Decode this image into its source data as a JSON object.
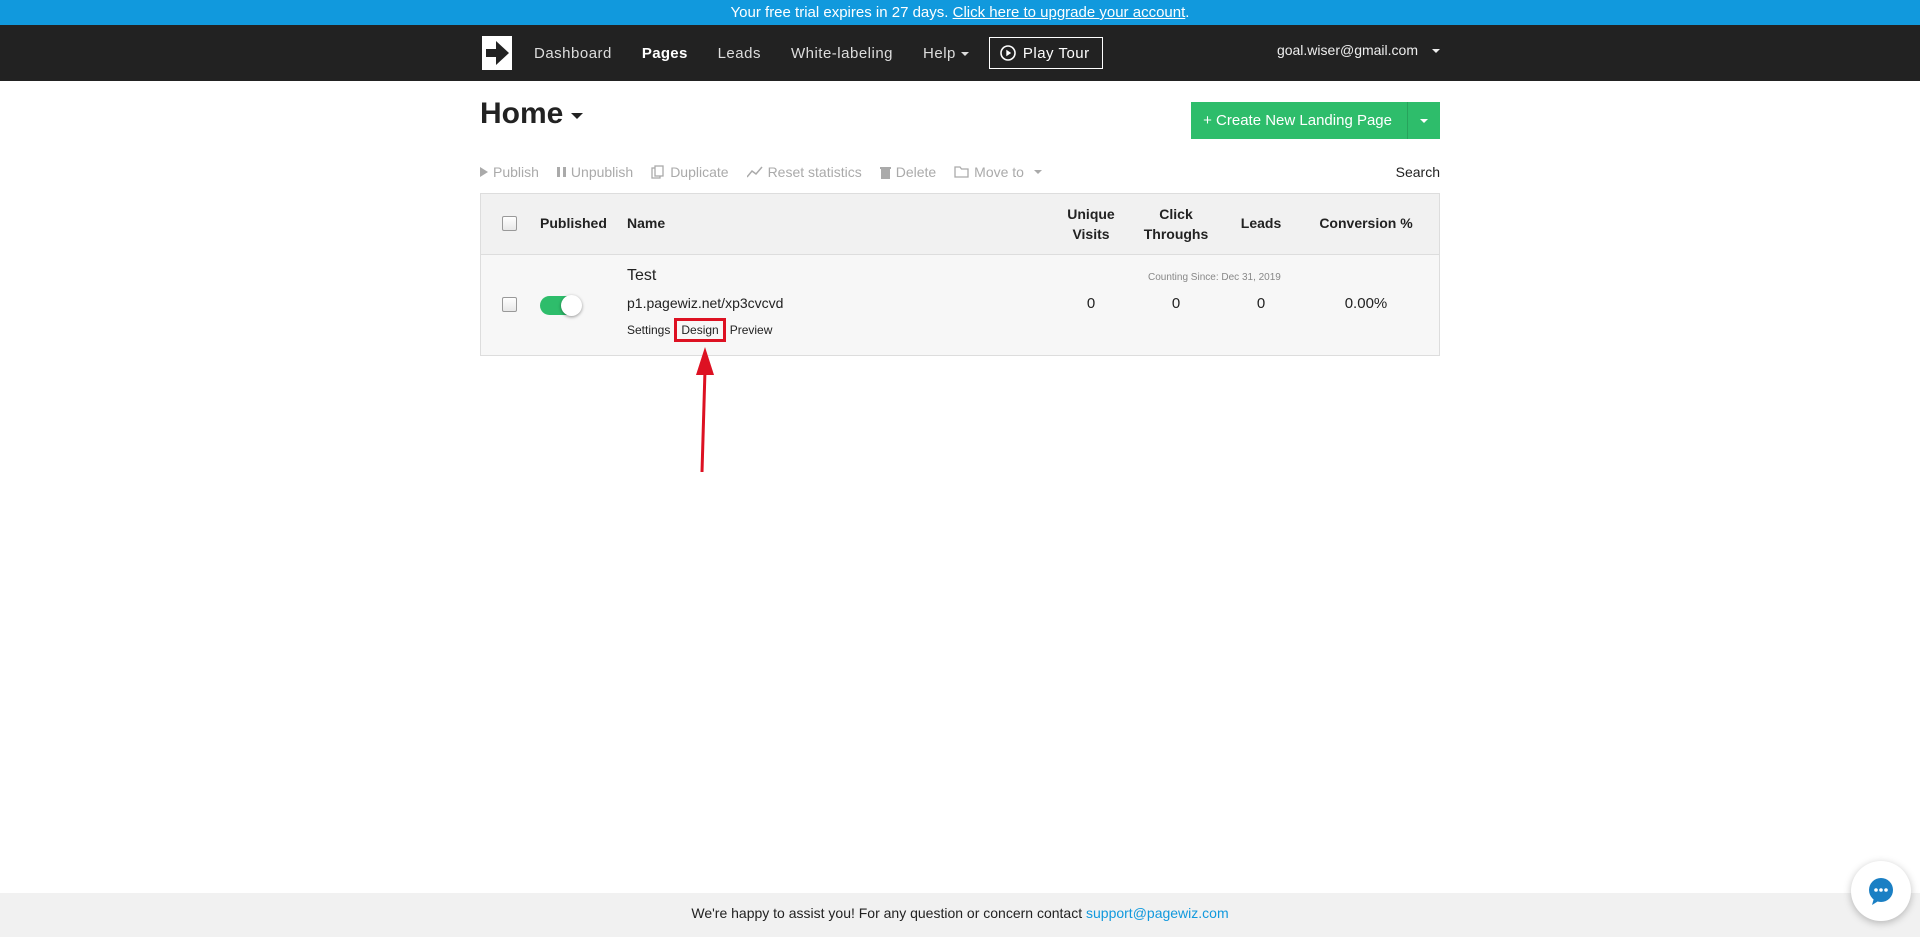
{
  "trial_bar": {
    "text": "Your free trial expires in 27 days.",
    "link": "Click here to upgrade your account",
    "period": "."
  },
  "nav": {
    "logo_icon": "arrow-right-logo-icon",
    "items": [
      "Dashboard",
      "Pages",
      "Leads",
      "White-labeling",
      "Help"
    ],
    "active": "Pages",
    "play_tour": "Play Tour",
    "user_email": "goal.wiser@gmail.com"
  },
  "header": {
    "title": "Home",
    "create_button": "+ Create New Landing Page"
  },
  "toolbar": {
    "publish": "Publish",
    "unpublish": "Unpublish",
    "duplicate": "Duplicate",
    "reset": "Reset statistics",
    "delete": "Delete",
    "move_to": "Move to",
    "search": "Search"
  },
  "table": {
    "columns": {
      "published": "Published",
      "name": "Name",
      "unique_visits_1": "Unique",
      "unique_visits_2": "Visits",
      "click_throughs_1": "Click",
      "click_throughs_2": "Throughs",
      "leads": "Leads",
      "conversion": "Conversion %"
    },
    "rows": [
      {
        "name": "Test",
        "url": "p1.pagewiz.net/xp3cvcvd",
        "links": {
          "settings": "Settings",
          "design": "Design",
          "preview": "Preview"
        },
        "counting_since": "Counting Since: Dec 31, 2019",
        "unique_visits": "0",
        "click_throughs": "0",
        "leads": "0",
        "conversion": "0.00%",
        "published": true
      }
    ]
  },
  "footer": {
    "text": "We're happy to assist you! For any question or concern contact ",
    "email": "support@pagewiz.com"
  },
  "colors": {
    "trial_bar": "#1199dd",
    "nav_bg": "#222222",
    "accent_green": "#2ebd6b",
    "annotation_red": "#dd1122"
  }
}
